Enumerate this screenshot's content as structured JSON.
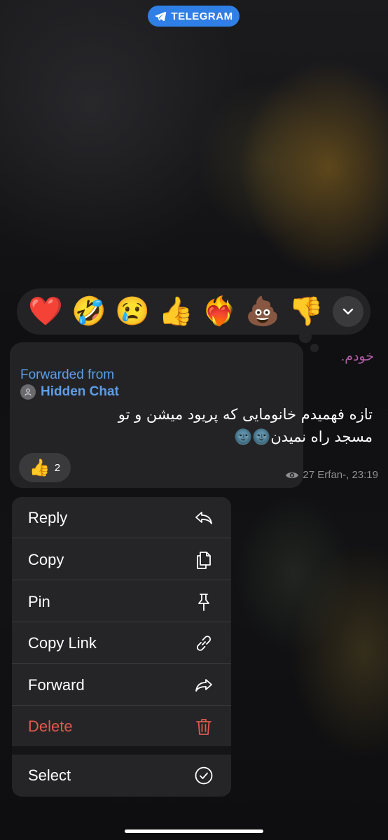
{
  "top_badge": {
    "label": "TELEGRAM",
    "icon": "telegram-plane-icon",
    "color": "#2f7fe6"
  },
  "reactions_bar": {
    "emojis": [
      "❤️",
      "🤣",
      "😢",
      "👍",
      "❤️‍🔥",
      "💩",
      "👎"
    ],
    "more_icon": "chevron-down-icon"
  },
  "message": {
    "sender": "خودم.",
    "forwarded_label": "Forwarded from",
    "forwarded_name": "Hidden Chat",
    "text": "تازه فهمیدم خانومایی که پریود میشن و تو مسجد راه نمیدن🌚🌚",
    "reaction": {
      "emoji": "👍",
      "count": "2"
    },
    "meta": "27 Erfan-, 23:19",
    "meta_icon": "eye-icon"
  },
  "context_menu": {
    "items": [
      {
        "label": "Reply",
        "icon": "reply-icon"
      },
      {
        "label": "Copy",
        "icon": "copy-icon"
      },
      {
        "label": "Pin",
        "icon": "pin-icon"
      },
      {
        "label": "Copy Link",
        "icon": "link-icon"
      },
      {
        "label": "Forward",
        "icon": "forward-icon"
      },
      {
        "label": "Delete",
        "icon": "trash-icon",
        "color": "#e0594f"
      },
      {
        "label": "Select",
        "icon": "check-circle-icon"
      }
    ]
  }
}
